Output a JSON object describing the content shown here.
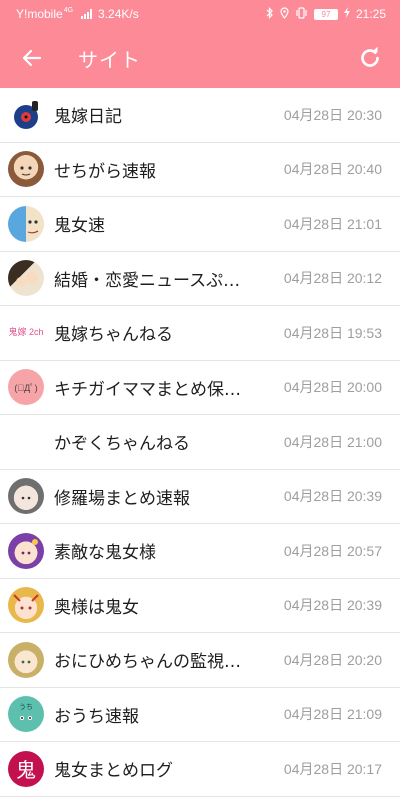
{
  "status_bar": {
    "carrier": "Y!mobile",
    "carrier_super": "4G",
    "speed": "3.24K/s",
    "battery": "97",
    "time": "21:25"
  },
  "app_bar": {
    "title": "サイト",
    "back_icon": "arrow-left-icon",
    "refresh_icon": "refresh-icon"
  },
  "colors": {
    "accent": "#fd8a97",
    "divider": "#e4e4e4",
    "time_text": "#9e9e9e"
  },
  "sites": [
    {
      "name": "鬼嫁日記",
      "time": "04月28日 20:30",
      "avatar": ""
    },
    {
      "name": "せちがら速報",
      "time": "04月28日 20:40",
      "avatar": ""
    },
    {
      "name": "鬼女速",
      "time": "04月28日 21:01",
      "avatar": ""
    },
    {
      "name": "結婚・恋愛ニュースぷ…",
      "time": "04月28日 20:12",
      "avatar": ""
    },
    {
      "name": "鬼嫁ちゃんねる",
      "time": "04月28日 19:53",
      "avatar": "鬼嫁 2ch"
    },
    {
      "name": "キチガイママまとめ保…",
      "time": "04月28日 20:00",
      "avatar": "(ﾟДﾟ)"
    },
    {
      "name": "かぞくちゃんねる",
      "time": "04月28日 21:00",
      "avatar": ""
    },
    {
      "name": "修羅場まとめ速報",
      "time": "04月28日 20:39",
      "avatar": ""
    },
    {
      "name": "素敵な鬼女様",
      "time": "04月28日 20:57",
      "avatar": ""
    },
    {
      "name": "奥様は鬼女",
      "time": "04月28日 20:39",
      "avatar": ""
    },
    {
      "name": "おにひめちゃんの監視…",
      "time": "04月28日 20:20",
      "avatar": ""
    },
    {
      "name": "おうち速報",
      "time": "04月28日 21:09",
      "avatar": "うち"
    },
    {
      "name": "鬼女まとめログ",
      "time": "04月28日 20:17",
      "avatar": "鬼"
    }
  ]
}
